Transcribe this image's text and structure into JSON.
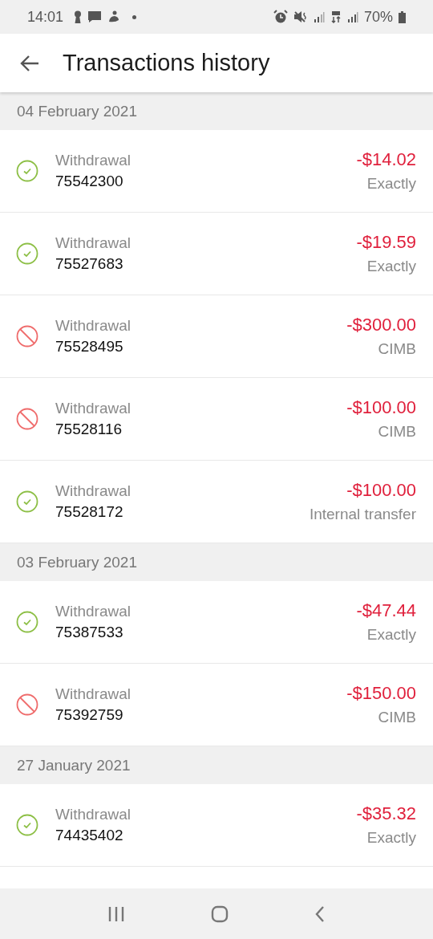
{
  "status_bar": {
    "time": "14:01",
    "battery": "70%"
  },
  "header": {
    "title": "Transactions history"
  },
  "groups": [
    {
      "date": "04 February 2021",
      "transactions": [
        {
          "kind": "success",
          "type": "Withdrawal",
          "id": "75542300",
          "amount": "-$14.02",
          "method": "Exactly"
        },
        {
          "kind": "success",
          "type": "Withdrawal",
          "id": "75527683",
          "amount": "-$19.59",
          "method": "Exactly"
        },
        {
          "kind": "failed",
          "type": "Withdrawal",
          "id": "75528495",
          "amount": "-$300.00",
          "method": "CIMB"
        },
        {
          "kind": "failed",
          "type": "Withdrawal",
          "id": "75528116",
          "amount": "-$100.00",
          "method": "CIMB"
        },
        {
          "kind": "success",
          "type": "Withdrawal",
          "id": "75528172",
          "amount": "-$100.00",
          "method": "Internal transfer"
        }
      ]
    },
    {
      "date": "03 February 2021",
      "transactions": [
        {
          "kind": "success",
          "type": "Withdrawal",
          "id": "75387533",
          "amount": "-$47.44",
          "method": "Exactly"
        },
        {
          "kind": "failed",
          "type": "Withdrawal",
          "id": "75392759",
          "amount": "-$150.00",
          "method": "CIMB"
        }
      ]
    },
    {
      "date": "27 January 2021",
      "transactions": [
        {
          "kind": "success",
          "type": "Withdrawal",
          "id": "74435402",
          "amount": "-$35.32",
          "method": "Exactly"
        }
      ]
    }
  ]
}
